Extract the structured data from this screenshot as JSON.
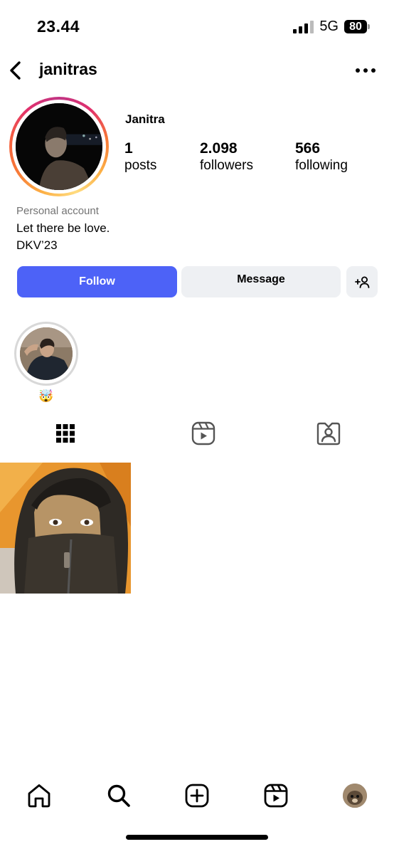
{
  "status_bar": {
    "time": "23.44",
    "network": "5G",
    "battery": "80"
  },
  "header": {
    "username": "janitras",
    "back_icon": "chevron-left-icon",
    "more_icon": "ellipsis-horizontal-icon"
  },
  "profile": {
    "display_name": "Janitra",
    "stats": [
      {
        "value": "1",
        "label": "posts"
      },
      {
        "value": "2.098",
        "label": "followers"
      },
      {
        "value": "566",
        "label": "following"
      }
    ],
    "account_type": "Personal account",
    "bio": [
      "Let there be love.",
      "DKV’23"
    ]
  },
  "actions": {
    "follow": "Follow",
    "message": "Message",
    "suggest_icon": "add-person-icon"
  },
  "highlights": [
    {
      "label": "🤯"
    }
  ],
  "tabs": [
    {
      "name": "posts-grid",
      "icon": "grid-icon",
      "active": true
    },
    {
      "name": "reels",
      "icon": "reels-icon",
      "active": false
    },
    {
      "name": "tagged",
      "icon": "tagged-person-icon",
      "active": false
    }
  ],
  "bottom_nav": [
    {
      "name": "home",
      "icon": "home-icon"
    },
    {
      "name": "search",
      "icon": "search-icon"
    },
    {
      "name": "create",
      "icon": "plus-square-icon"
    },
    {
      "name": "reels",
      "icon": "reels-icon"
    },
    {
      "name": "profile",
      "icon": "profile-avatar"
    }
  ],
  "colors": {
    "follow_button": "#4d62f7",
    "secondary_button": "#eef0f3",
    "muted_text": "#737373"
  }
}
